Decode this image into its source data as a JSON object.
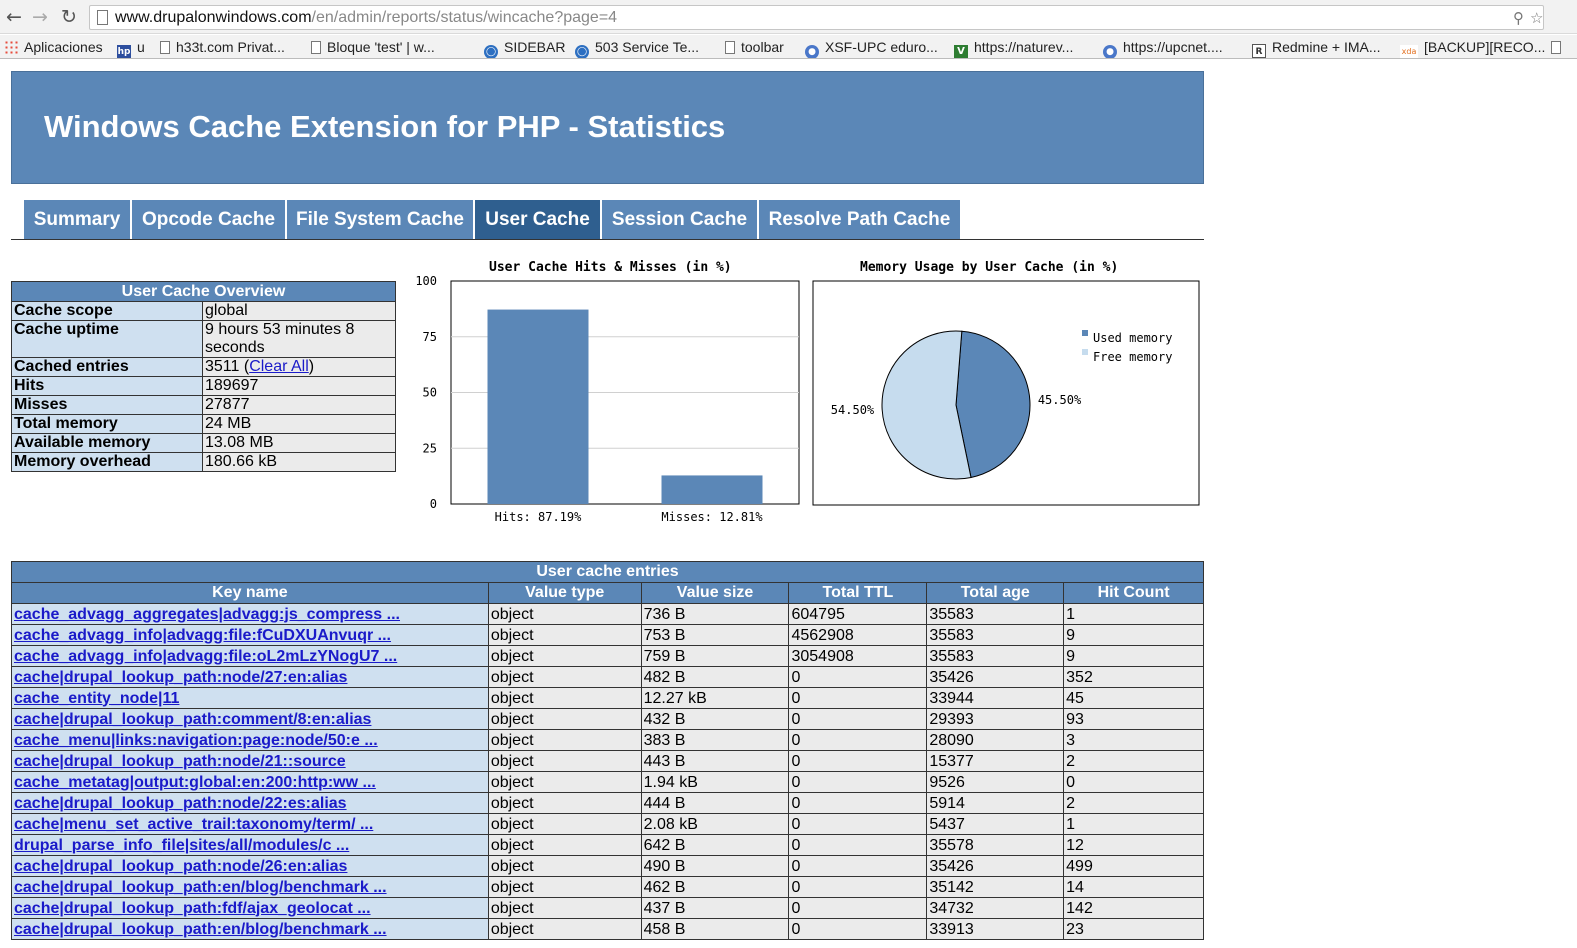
{
  "browser": {
    "url_host": "www.drupalonwindows.com",
    "url_path": "/en/admin/reports/status/wincache?page=4",
    "bookmarks": [
      {
        "label": "Aplicaciones",
        "icon": "apps-grid-icon"
      },
      {
        "label": "u",
        "icon": "hp-icon"
      },
      {
        "label": "h33t.com Privat...",
        "icon": "page-icon"
      },
      {
        "label": "Bloque 'test' | w...",
        "icon": "page-icon"
      },
      {
        "label": "SIDEBAR",
        "icon": "blue-circle-icon"
      },
      {
        "label": "503 Service Te...",
        "icon": "blue-circle-icon"
      },
      {
        "label": "toolbar",
        "icon": "page-icon"
      },
      {
        "label": "XSF-UPC eduro...",
        "icon": "globe-icon"
      },
      {
        "label": "https://naturev...",
        "icon": "v-icon"
      },
      {
        "label": "https://upcnet....",
        "icon": "globe-icon"
      },
      {
        "label": "Redmine + IMA...",
        "icon": "redmine-icon"
      },
      {
        "label": "[BACKUP][RECO...",
        "icon": "xda-icon"
      }
    ]
  },
  "header": {
    "title": "Windows Cache Extension for PHP - Statistics"
  },
  "tabs": [
    {
      "label": "Summary",
      "active": false
    },
    {
      "label": "Opcode Cache",
      "active": false
    },
    {
      "label": "File System Cache",
      "active": false
    },
    {
      "label": "User Cache",
      "active": true
    },
    {
      "label": "Session Cache",
      "active": false
    },
    {
      "label": "Resolve Path Cache",
      "active": false
    }
  ],
  "overview": {
    "title": "User Cache Overview",
    "rows": [
      {
        "key": "Cache scope",
        "value": "global"
      },
      {
        "key": "Cache uptime",
        "value": "9 hours 53 minutes 8 seconds"
      },
      {
        "key": "Cached entries",
        "value": "3511",
        "link": "Clear All"
      },
      {
        "key": "Hits",
        "value": "189697"
      },
      {
        "key": "Misses",
        "value": "27877"
      },
      {
        "key": "Total memory",
        "value": "24 MB"
      },
      {
        "key": "Available memory",
        "value": "13.08 MB"
      },
      {
        "key": "Memory overhead",
        "value": "180.66 kB"
      }
    ]
  },
  "colors": {
    "primary": "#5b87b7",
    "active_tab": "#2f5f8f",
    "key_cell": "#cfe0f0",
    "value_cell": "#ebebeb",
    "free_memory": "#c6dcee",
    "link": "#1a1ac9"
  },
  "chart_data": [
    {
      "type": "bar",
      "title": "User Cache Hits & Misses (in %)",
      "categories": [
        "Hits: 87.19%",
        "Misses: 12.81%"
      ],
      "values": [
        87.19,
        12.81
      ],
      "ylim": [
        0,
        100
      ],
      "yticks": [
        0,
        25,
        50,
        75,
        100
      ],
      "grid": true
    },
    {
      "type": "pie",
      "title": "Memory Usage by User Cache (in %)",
      "slices": [
        {
          "label": "Used memory",
          "value": 45.5,
          "text": "45.50%",
          "color": "#5b87b7"
        },
        {
          "label": "Free memory",
          "value": 54.5,
          "text": "54.50%",
          "color": "#c6dcee"
        }
      ],
      "legend": "top-right"
    }
  ],
  "entries": {
    "title": "User cache entries",
    "columns": [
      "Key name",
      "Value type",
      "Value size",
      "Total TTL",
      "Total age",
      "Hit Count"
    ],
    "rows": [
      [
        "cache_advagg_aggregates|advagg:js_compress ...",
        "object",
        "736 B",
        "604795",
        "35583",
        "1"
      ],
      [
        "cache_advagg_info|advagg:file:fCuDXUAnvuqr ...",
        "object",
        "753 B",
        "4562908",
        "35583",
        "9"
      ],
      [
        "cache_advagg_info|advagg:file:oL2mLzYNogU7 ...",
        "object",
        "759 B",
        "3054908",
        "35583",
        "9"
      ],
      [
        "cache|drupal_lookup_path:node/27:en:alias",
        "object",
        "482 B",
        "0",
        "35426",
        "352"
      ],
      [
        "cache_entity_node|11",
        "object",
        "12.27 kB",
        "0",
        "33944",
        "45"
      ],
      [
        "cache|drupal_lookup_path:comment/8:en:alias",
        "object",
        "432 B",
        "0",
        "29393",
        "93"
      ],
      [
        "cache_menu|links:navigation:page:node/50:e ...",
        "object",
        "383 B",
        "0",
        "28090",
        "3"
      ],
      [
        "cache|drupal_lookup_path:node/21::source",
        "object",
        "443 B",
        "0",
        "15377",
        "2"
      ],
      [
        "cache_metatag|output:global:en:200:http:ww ...",
        "object",
        "1.94 kB",
        "0",
        "9526",
        "0"
      ],
      [
        "cache|drupal_lookup_path:node/22:es:alias",
        "object",
        "444 B",
        "0",
        "5914",
        "2"
      ],
      [
        "cache|menu_set_active_trail:taxonomy/term/ ...",
        "object",
        "2.08 kB",
        "0",
        "5437",
        "1"
      ],
      [
        "drupal_parse_info_file|sites/all/modules/c ...",
        "object",
        "642 B",
        "0",
        "35578",
        "12"
      ],
      [
        "cache|drupal_lookup_path:node/26:en:alias",
        "object",
        "490 B",
        "0",
        "35426",
        "499"
      ],
      [
        "cache|drupal_lookup_path:en/blog/benchmark ...",
        "object",
        "462 B",
        "0",
        "35142",
        "14"
      ],
      [
        "cache|drupal_lookup_path:fdf/ajax_geolocat ...",
        "object",
        "437 B",
        "0",
        "34732",
        "142"
      ],
      [
        "cache|drupal_lookup_path:en/blog/benchmark ...",
        "object",
        "458 B",
        "0",
        "33913",
        "23"
      ]
    ]
  }
}
